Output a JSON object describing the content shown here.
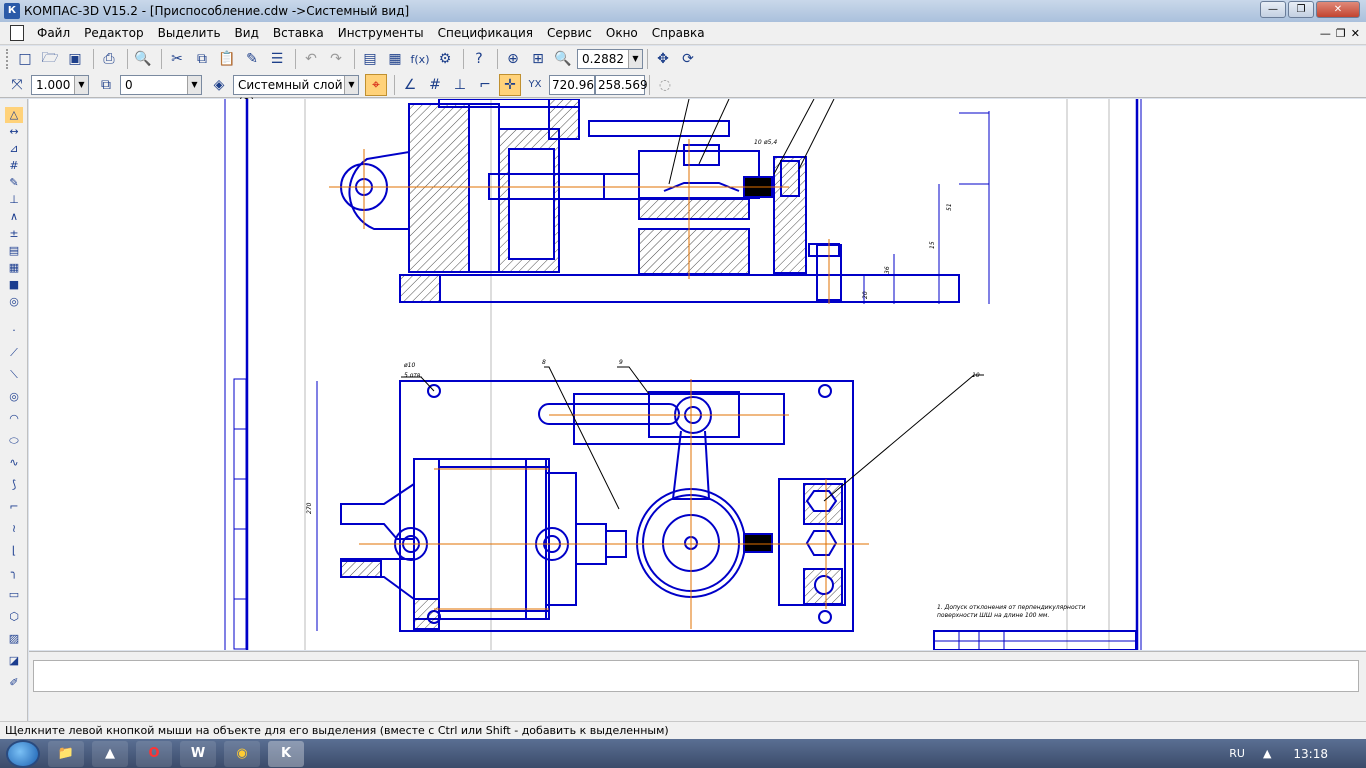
{
  "window": {
    "title": "КОМПАС-3D V15.2  - [Приспособление.cdw ->Системный вид]",
    "app_icon": "К",
    "buttons": [
      "—",
      "❐",
      "✕"
    ]
  },
  "menu": [
    "Файл",
    "Редактор",
    "Выделить",
    "Вид",
    "Вставка",
    "Инструменты",
    "Спецификация",
    "Сервис",
    "Окно",
    "Справка"
  ],
  "mdi_buttons": [
    "—",
    "❐",
    "✕"
  ],
  "toolbar1": {
    "zoom_value": "0.2882"
  },
  "toolbar2": {
    "scale_value": "1.000",
    "state_value": "0",
    "layer_value": "Системный слой (0)",
    "coord_x": "720.9636",
    "coord_y": "258.569"
  },
  "drawing": {
    "dim_diameter": "ø10",
    "dim_note_small": "5 отв.",
    "dim_side": "270",
    "dim_top_1": "51",
    "dim_top_2": "15",
    "dim_top_3": "36",
    "dim_top_4": "20",
    "dim_top_5": "10",
    "dim_top_6": "ø5,4",
    "callout_8": "8",
    "callout_9": "9",
    "callout_10": "10",
    "note_line1": "1. Допуск отклонения от перпендикулярности",
    "note_line2": "поверхности ШШ на длине 100 мм."
  },
  "status_text": "Щелкните левой кнопкой мыши на объекте для его выделения (вместе с Ctrl или Shift - добавить к выделенным)",
  "taskbar": {
    "apps": [
      "📁",
      "▲",
      "O",
      "W",
      "◉",
      "K"
    ],
    "lang": "RU",
    "clock": "13:18"
  },
  "colors": {
    "drawing_blue": "#0000c8",
    "axis_orange": "#e07000",
    "hatch": "#000000"
  }
}
